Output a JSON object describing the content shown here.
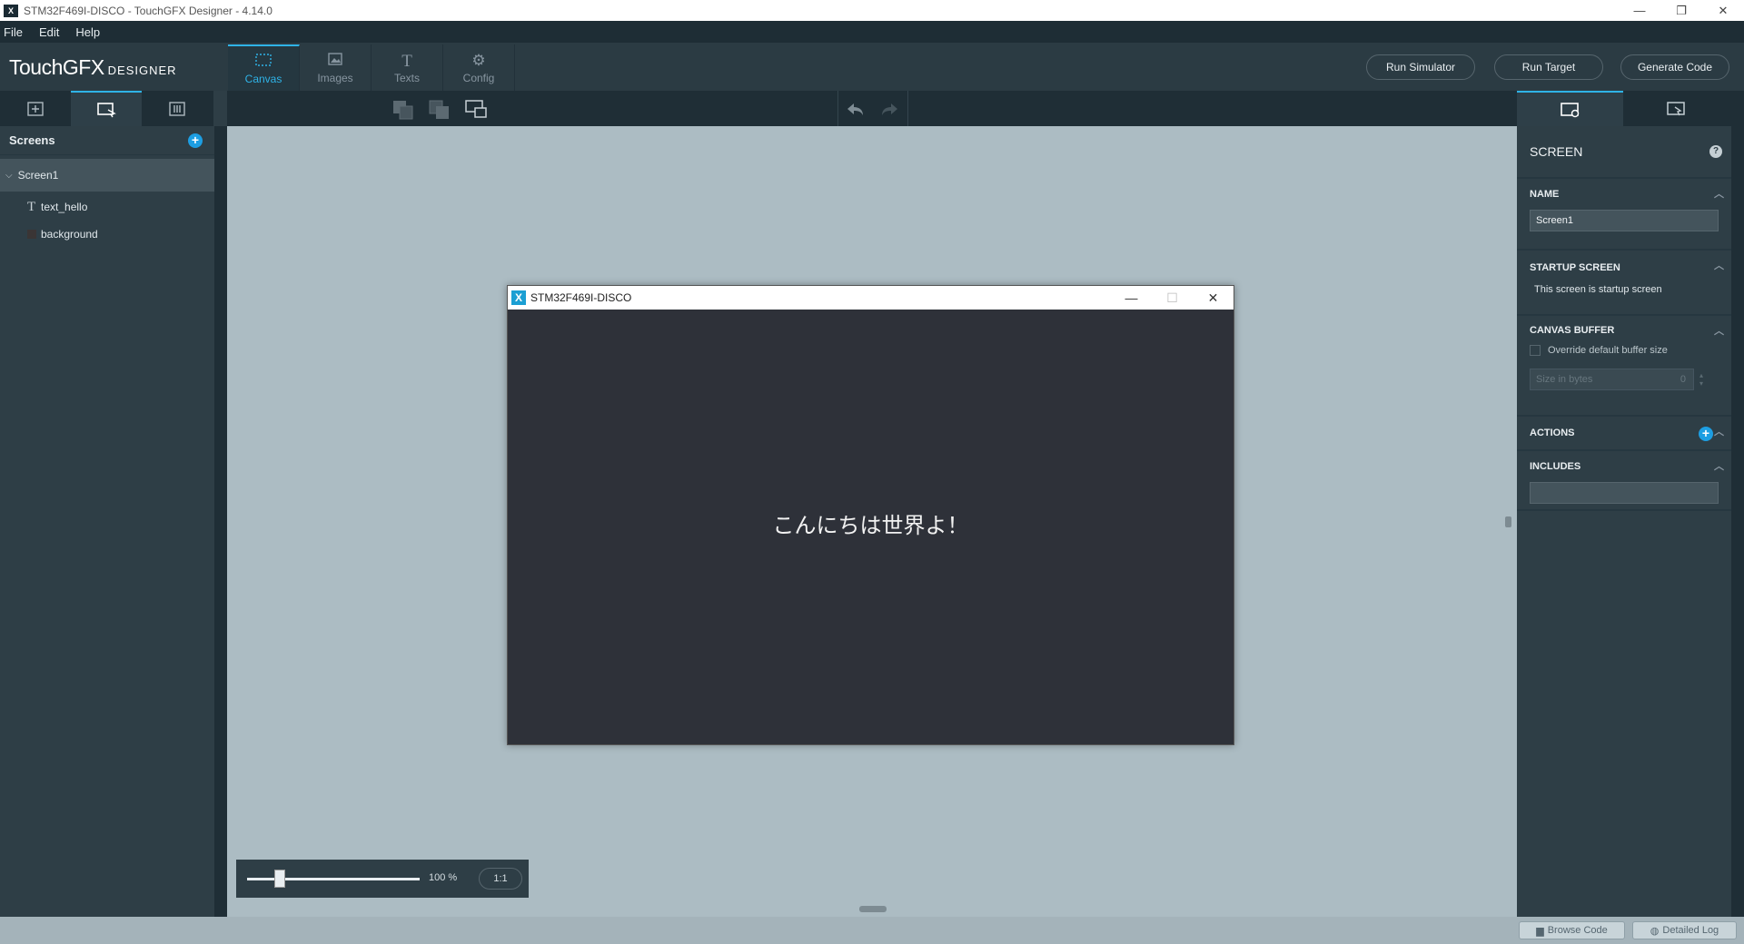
{
  "window": {
    "title": "STM32F469I-DISCO - TouchGFX Designer - 4.14.0",
    "icon_name": "touchgfx-app-icon",
    "controls": {
      "minimize": "—",
      "restore": "❐",
      "close": "✕"
    }
  },
  "menu": {
    "items": [
      "File",
      "Edit",
      "Help"
    ]
  },
  "header": {
    "logo_main": "TouchGFX",
    "logo_suffix": "DESIGNER",
    "tabs": [
      {
        "label": "Canvas",
        "icon": "canvas-icon",
        "active": true
      },
      {
        "label": "Images",
        "icon": "images-icon",
        "active": false
      },
      {
        "label": "Texts",
        "icon": "texts-icon",
        "active": false
      },
      {
        "label": "Config",
        "icon": "config-icon",
        "active": false
      }
    ],
    "buttons": {
      "run_simulator": "Run Simulator",
      "run_target": "Run Target",
      "generate_code": "Generate Code"
    }
  },
  "left_panel": {
    "screens_title": "Screens",
    "tree": {
      "screen": "Screen1",
      "children": [
        "text_hello",
        "background"
      ]
    }
  },
  "simulator": {
    "title": "STM32F469I-DISCO",
    "text": "こんにちは世界よ！"
  },
  "zoom": {
    "value": "100 %",
    "reset_label": "1:1",
    "level_fraction": 0.19
  },
  "right_panel": {
    "title": "SCREEN",
    "sections": {
      "name": {
        "label": "NAME",
        "value": "Screen1"
      },
      "startup": {
        "label": "STARTUP SCREEN",
        "text": "This screen is startup screen"
      },
      "canvas_buffer": {
        "label": "CANVAS BUFFER",
        "override_label": "Override default buffer size",
        "size_placeholder": "Size in bytes",
        "size_value": "0"
      },
      "actions": {
        "label": "ACTIONS"
      },
      "includes": {
        "label": "INCLUDES"
      }
    }
  },
  "status_bar": {
    "browse_code": "Browse Code",
    "detailed_log": "Detailed Log"
  },
  "colors": {
    "accent": "#2fb3e7",
    "panel": "#2e3e46",
    "canvas": "#acbcc3",
    "sim_bg": "#2e3139"
  }
}
